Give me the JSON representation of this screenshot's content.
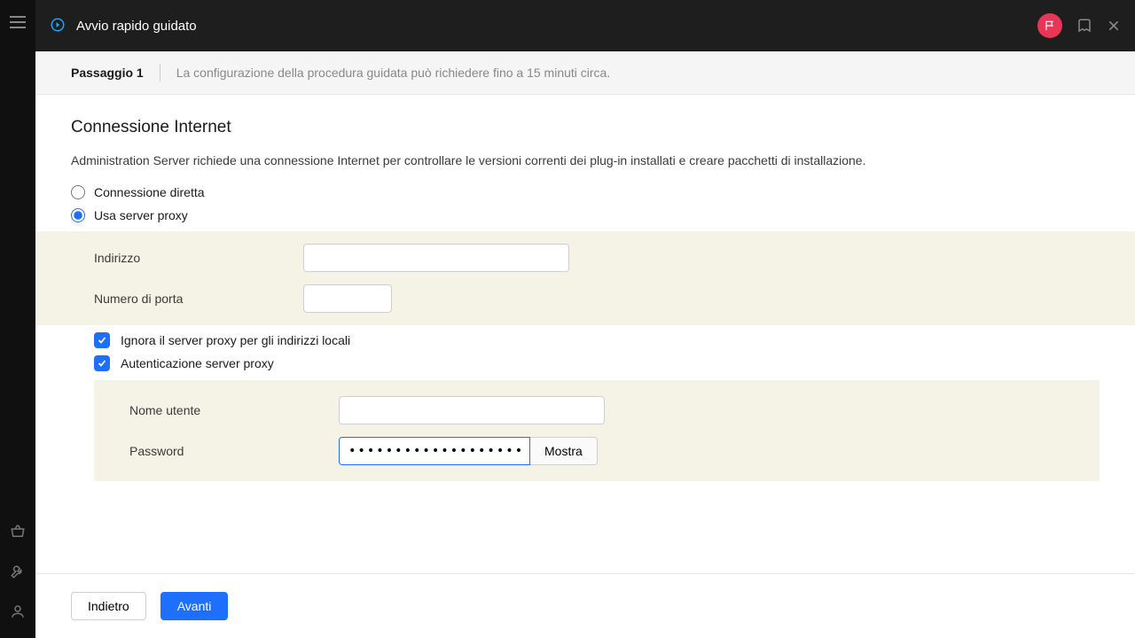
{
  "header": {
    "title": "Avvio rapido guidato"
  },
  "stepbar": {
    "step": "Passaggio 1",
    "subtitle": "La configurazione della procedura guidata può richiedere fino a 15 minuti circa."
  },
  "section": {
    "title": "Connessione Internet",
    "description": "Administration Server richiede una connessione Internet per controllare le versioni correnti dei plug-in installati e creare pacchetti di installazione."
  },
  "radios": {
    "direct": "Connessione diretta",
    "proxy": "Usa server proxy"
  },
  "form": {
    "address_label": "Indirizzo",
    "address_value": "",
    "port_label": "Numero di porta",
    "port_value": "",
    "bypass_local": "Ignora il server proxy per gli indirizzi locali",
    "proxy_auth": "Autenticazione server proxy",
    "username_label": "Nome utente",
    "username_value": "",
    "password_label": "Password",
    "password_value": "•••••••••••••••••••••••••••",
    "show_label": "Mostra"
  },
  "footer": {
    "back": "Indietro",
    "next": "Avanti"
  }
}
